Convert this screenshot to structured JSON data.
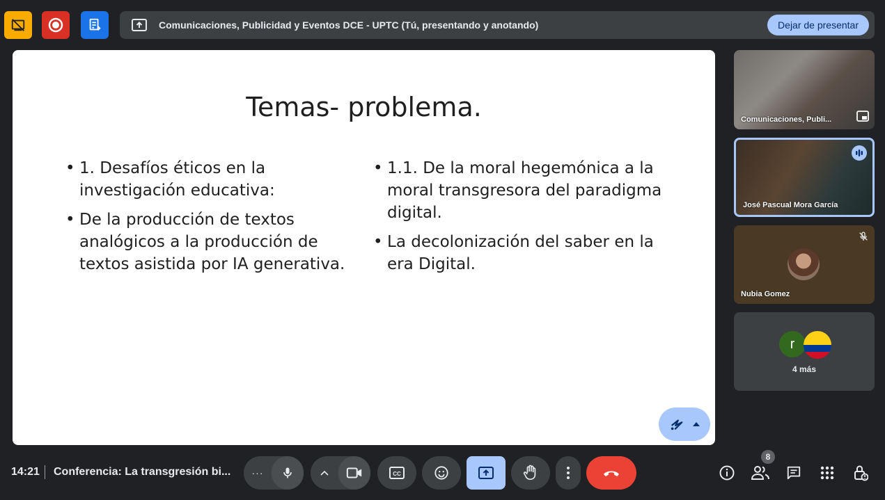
{
  "top_bar": {
    "banner_text": "Comunicaciones, Publicidad y Eventos DCE - UPTC (Tú, presentando y anotando)",
    "stop_button": "Dejar de presentar"
  },
  "slide": {
    "title": "Temas- problema.",
    "left_bullets": [
      "1. Desafíos éticos en la investigación educativa:",
      "De la producción de textos analógicos a la producción de textos asistida por IA generativa."
    ],
    "right_bullets": [
      "1.1. De la moral hegemónica a la moral transgresora del paradigma digital.",
      "La decolonización del saber en la era Digital."
    ]
  },
  "participants": [
    {
      "name": "Comunicaciones, Publi..."
    },
    {
      "name": "José Pascual Mora García"
    },
    {
      "name": "Nubia Gomez"
    }
  ],
  "more": {
    "avatar_letter": "r",
    "label": "4 más"
  },
  "bottom_bar": {
    "time": "14:21",
    "meeting": "Conferencia: La transgresión bi...",
    "more_dots": "···",
    "participant_count": "8"
  },
  "colors": {
    "accent": "#a8c7fa",
    "leave": "#ea4335",
    "bg": "#202124"
  }
}
